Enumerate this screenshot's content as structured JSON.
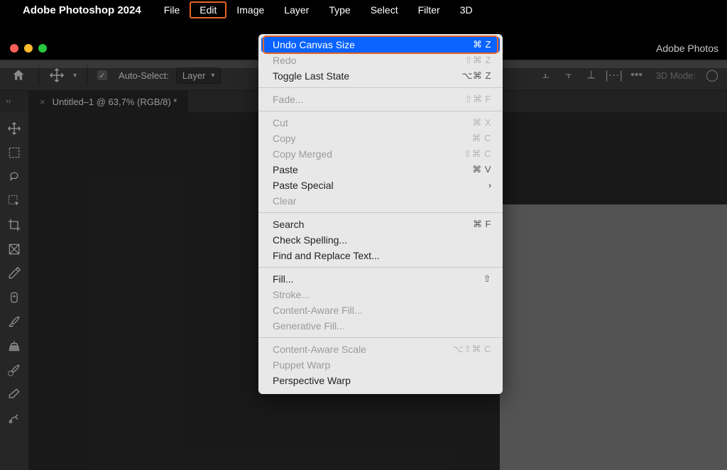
{
  "menubar": {
    "app_name": "Adobe Photoshop 2024",
    "items": [
      "File",
      "Edit",
      "Image",
      "Layer",
      "Type",
      "Select",
      "Filter",
      "3D"
    ],
    "active_index": 1
  },
  "window": {
    "title_right": "Adobe Photos"
  },
  "options_bar": {
    "auto_select_label": "Auto-Select:",
    "layer_dropdown": "Layer",
    "mode_label": "3D Mode:"
  },
  "document_tab": {
    "title": "Untitled–1 @ 63,7% (RGB/8) *"
  },
  "edit_menu": {
    "groups": [
      [
        {
          "label": "Undo Canvas Size",
          "shortcut": "⌘ Z",
          "highlighted": true,
          "disabled": false
        },
        {
          "label": "Redo",
          "shortcut": "⇧⌘ Z",
          "disabled": true
        },
        {
          "label": "Toggle Last State",
          "shortcut": "⌥⌘ Z",
          "disabled": false
        }
      ],
      [
        {
          "label": "Fade...",
          "shortcut": "⇧⌘ F",
          "disabled": true
        }
      ],
      [
        {
          "label": "Cut",
          "shortcut": "⌘ X",
          "disabled": true
        },
        {
          "label": "Copy",
          "shortcut": "⌘ C",
          "disabled": true
        },
        {
          "label": "Copy Merged",
          "shortcut": "⇧⌘ C",
          "disabled": true
        },
        {
          "label": "Paste",
          "shortcut": "⌘ V",
          "disabled": false
        },
        {
          "label": "Paste Special",
          "submenu": true,
          "disabled": false
        },
        {
          "label": "Clear",
          "disabled": true
        }
      ],
      [
        {
          "label": "Search",
          "shortcut": "⌘ F",
          "disabled": false
        },
        {
          "label": "Check Spelling...",
          "disabled": false
        },
        {
          "label": "Find and Replace Text...",
          "disabled": false
        }
      ],
      [
        {
          "label": "Fill...",
          "shortcut": "⇧",
          "disabled": false
        },
        {
          "label": "Stroke...",
          "disabled": true
        },
        {
          "label": "Content-Aware Fill...",
          "disabled": true
        },
        {
          "label": "Generative Fill...",
          "disabled": true
        }
      ],
      [
        {
          "label": "Content-Aware Scale",
          "shortcut": "⌥⇧⌘ C",
          "disabled": true
        },
        {
          "label": "Puppet Warp",
          "disabled": true
        },
        {
          "label": "Perspective Warp",
          "disabled": false
        }
      ]
    ]
  },
  "tools": [
    "move-tool",
    "marquee-tool",
    "lasso-tool",
    "quick-select-tool",
    "crop-tool",
    "frame-tool",
    "eyedropper-tool",
    "healing-brush-tool",
    "brush-tool",
    "stamp-tool",
    "history-brush-tool",
    "eraser-tool",
    "gradient-tool"
  ]
}
